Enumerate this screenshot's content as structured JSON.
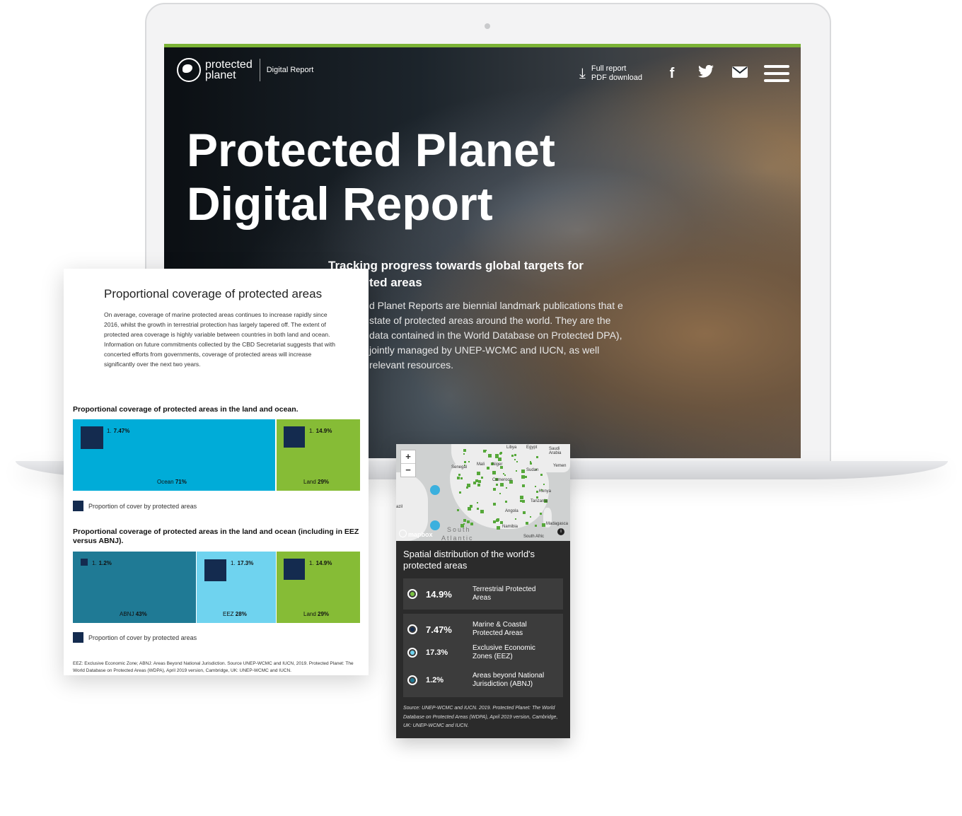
{
  "site": {
    "logo_line1": "protected",
    "logo_line2": "planet",
    "logo_sub": "Digital Report",
    "download_line1": "Full report",
    "download_line2": "PDF download",
    "hero_title_line1": "Protected Planet",
    "hero_title_line2": "Digital Report",
    "hero_sub_line1": "Tracking progress towards global targets for",
    "hero_sub_line2": "ted areas",
    "hero_body": "d Planet Reports are biennial landmark publications that e state of protected areas around the world. They are the data contained in the World Database on Protected DPA), jointly managed by UNEP-WCMC and IUCN, as well relevant resources."
  },
  "doc": {
    "title": "Proportional coverage of protected areas",
    "paragraph": "On average, coverage of marine protected areas continues to increase rapidly since 2016, whilst the growth in terrestrial protection has largely tapered off. The extent of protected area coverage is highly variable between countries in both land and ocean. Information on future commitments collected by the CBD Secretariat suggests that with concerted efforts from governments, coverage of protected areas will increase significantly over the next two years.",
    "legend_label": "Proportion of cover by protected areas",
    "footnote": "EEZ: Exclusive Economic Zone; ABNJ: Areas Beyond National Jurisdiction. Source UNEP-WCMC and IUCN, 2019. Protected Planet: The World Database on Protected Areas (WDPA), April 2019 version, Cambridge, UK: UNEP-WCMC and IUCN."
  },
  "chart_data": [
    {
      "type": "treemap",
      "title": "Proportional coverage of protected areas in the land and ocean.",
      "series": [
        {
          "name": "Ocean",
          "share_pct": 71,
          "protected_pct": 7.47,
          "color": "#00acd8"
        },
        {
          "name": "Land",
          "share_pct": 29,
          "protected_pct": 14.9,
          "color": "#86bc36"
        }
      ],
      "legend": "Proportion of cover by protected areas"
    },
    {
      "type": "treemap",
      "title": "Proportional coverage of protected areas in the land and ocean (including in EEZ versus ABNJ).",
      "series": [
        {
          "name": "ABNJ",
          "share_pct": 43,
          "protected_pct": 1.2,
          "color": "#1f7a95"
        },
        {
          "name": "EEZ",
          "share_pct": 28,
          "protected_pct": 17.3,
          "color": "#6fd3ef"
        },
        {
          "name": "Land",
          "share_pct": 29,
          "protected_pct": 14.9,
          "color": "#86bc36"
        }
      ],
      "legend": "Proportion of cover by protected areas"
    }
  ],
  "tile_text": {
    "ocean_value": "7.47%",
    "ocean_label_name": "Ocean",
    "ocean_label_pct": "71%",
    "land_value": "14.9%",
    "land_label_name": "Land",
    "land_label_pct": "29%",
    "abnj_value": "1.2%",
    "abnj_label_name": "ABNJ",
    "abnj_label_pct": "43%",
    "eez_value": "17.3%",
    "eez_label_name": "EEZ",
    "eez_label_pct": "28%",
    "rank": "1."
  },
  "map": {
    "heading": "Spatial distribution of the world's protected areas",
    "zoom_in": "+",
    "zoom_out": "−",
    "mapbox": "mapbox",
    "south_label": "South",
    "atlantic_label": "Atlantic",
    "place_labels": [
      "Libya",
      "Egypt",
      "Saudi Arabia",
      "Senegal",
      "Mali",
      "Niger",
      "Sudan",
      "Yemen",
      "Cameroon",
      "Kenya",
      "Tanzania",
      "Angola",
      "Namibia",
      "Madagasca",
      "South Afric",
      "azil"
    ],
    "stats": [
      {
        "value": "14.9%",
        "label": "Terrestrial Protected Areas",
        "color": "#7ac143"
      },
      {
        "value": "7.47%",
        "label": "Marine & Coastal Protected Areas",
        "color": "#142b4f"
      },
      {
        "value": "17.3%",
        "label": "Exclusive Economic Zones (EEZ)",
        "color": "#6fd3ef"
      },
      {
        "value": "1.2%",
        "label": "Areas beyond National Jurisdiction (ABNJ)",
        "color": "#1f7a95"
      }
    ],
    "source": "Source: UNEP-WCMC and IUCN. 2019. Protected Planet: The World Database on Protected Areas (WDPA), April 2019 version, Cambridge, UK: UNEP-WCMC and IUCN."
  },
  "icons": {
    "download": "download-icon",
    "facebook": "facebook-icon",
    "twitter": "twitter-icon",
    "mail": "mail-icon",
    "menu": "hamburger-menu-icon"
  }
}
